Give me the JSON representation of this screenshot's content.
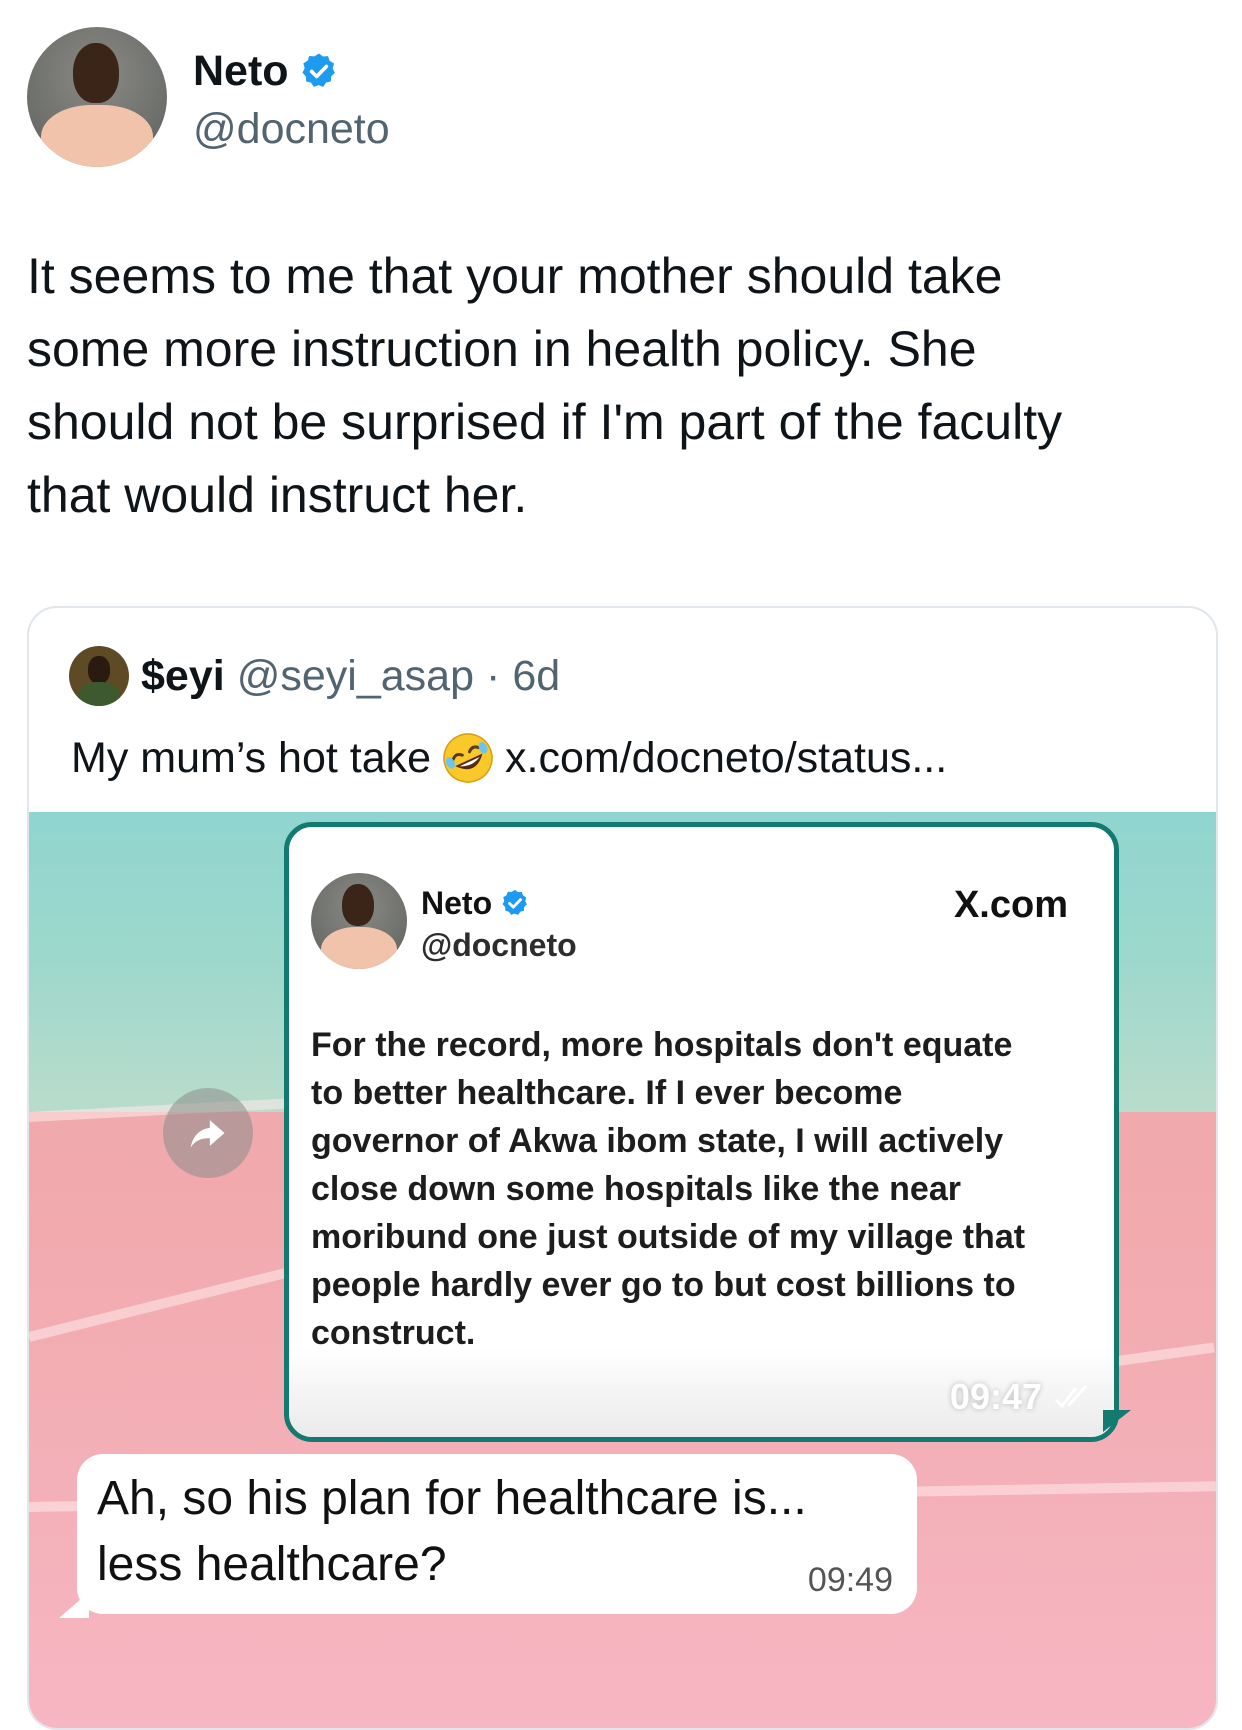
{
  "tweet": {
    "author": {
      "name": "Neto",
      "handle": "@docneto",
      "verified_icon": "verified-badge-icon",
      "verified_color": "#1d9bf0"
    },
    "text": "It seems to me that your mother should take\nsome more instruction in health policy. She\nshould not be surprised if I'm part of the faculty\nthat would instruct her."
  },
  "quote": {
    "author_name": "$eyi",
    "author_handle": "@seyi_asap",
    "separator": "·",
    "time": "6d",
    "text": "My mum’s hot take",
    "emoji": "rolling-on-floor-laughing-emoji",
    "link": "x.com/docneto/status..."
  },
  "media": {
    "share_icon": "share-arrow-icon",
    "shared_post": {
      "name": "Neto",
      "handle": "@docneto",
      "brand": "X.com",
      "text": "For the record, more hospitals don't equate\nto better healthcare. If I ever become\ngovernor of Akwa ibom state, I will actively\nclose down some hospitals like the near\nmoribund one just outside of my village that\npeople hardly ever go to but cost billions to\nconstruct.",
      "time": "09:47",
      "border_color": "#137a70"
    },
    "reply": {
      "text": "Ah, so his plan for healthcare is...\nless healthcare?",
      "time": "09:49"
    }
  }
}
